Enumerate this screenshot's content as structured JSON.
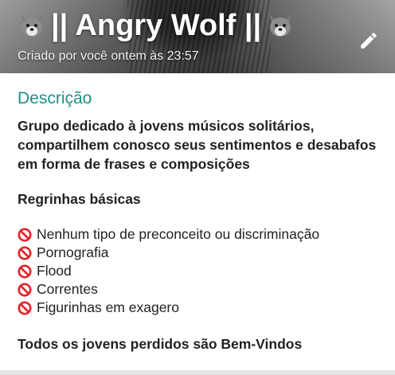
{
  "header": {
    "title": "|| Angry Wolf ||",
    "subtitle": "Criado por você ontem às 23:57",
    "left_icon": "wolf-icon",
    "right_icon": "wolf-icon",
    "edit_icon": "pencil-icon"
  },
  "description": {
    "section_title": "Descrição",
    "text": "Grupo dedicado à jovens músicos solitários, compartilhem conosco seus sentimentos e desabafos em forma de frases e composições",
    "rules_title": "Regrinhas básicas",
    "rules": [
      {
        "icon": "prohibited-icon",
        "label": "Nenhum tipo de preconceito ou discriminação"
      },
      {
        "icon": "prohibited-icon",
        "label": "Pornografia"
      },
      {
        "icon": "prohibited-icon",
        "label": "Flood"
      },
      {
        "icon": "prohibited-icon",
        "label": "Correntes"
      },
      {
        "icon": "prohibited-icon",
        "label": "Figurinhas em exagero"
      }
    ],
    "closing": "Todos os jovens perdidos são Bem-Vindos"
  },
  "colors": {
    "accent": "#1e8f86",
    "text": "#222222",
    "prohibited": "#e0262a"
  }
}
